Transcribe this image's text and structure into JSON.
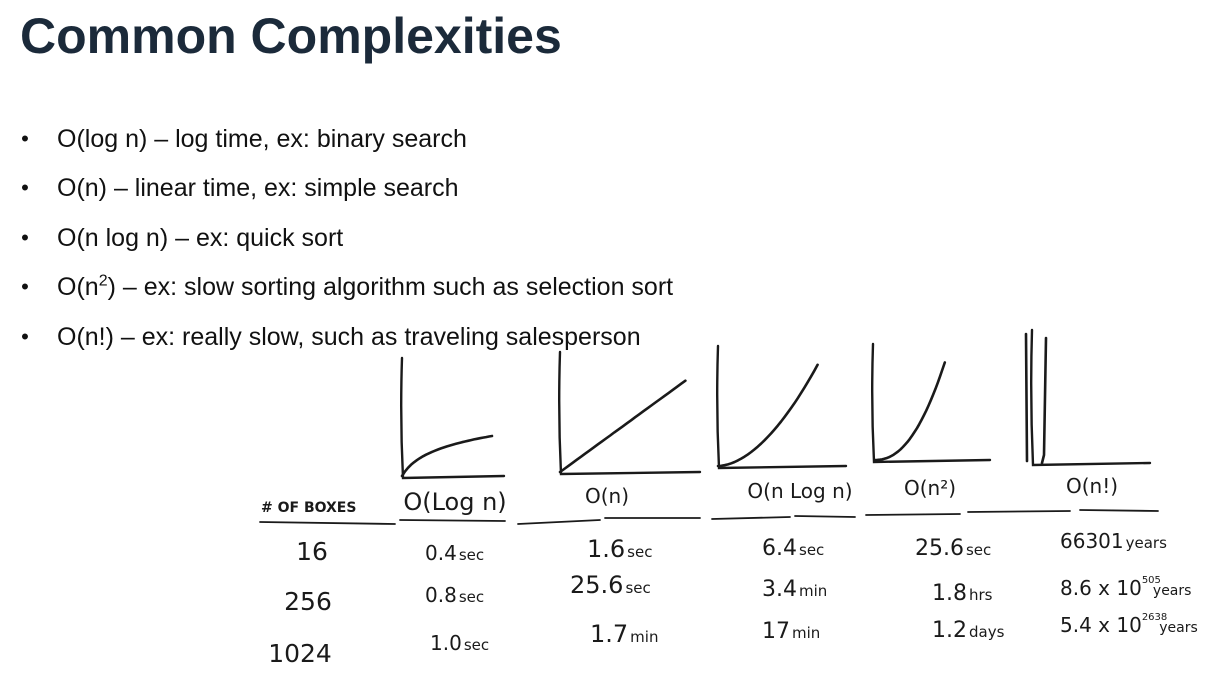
{
  "slide": {
    "title": "Common Complexities",
    "bullets": [
      {
        "marker": "•",
        "text_before": "O(log n) – log time, ex: binary search",
        "sup": "",
        "text_after": ""
      },
      {
        "marker": "•",
        "text_before": "O(n) – linear time, ex: simple search",
        "sup": "",
        "text_after": ""
      },
      {
        "marker": "•",
        "text_before": "O(n log n) – ex: quick sort",
        "sup": "",
        "text_after": ""
      },
      {
        "marker": "•",
        "text_before": "O(n",
        "sup": "2",
        "text_after": ") – ex: slow sorting algorithm such as selection sort"
      },
      {
        "marker": "•",
        "text_before": "O(n!) – ex: really slow, such as traveling salesperson",
        "sup": "",
        "text_after": ""
      }
    ]
  },
  "sketch": {
    "row_header": "# OF BOXES",
    "columns": [
      {
        "label": "O(Log n)",
        "curve": "log"
      },
      {
        "label": "O(n)",
        "curve": "linear"
      },
      {
        "label": "O(n Log n)",
        "curve": "nlogn"
      },
      {
        "label": "O(n²)",
        "curve": "square"
      },
      {
        "label": "O(n!)",
        "curve": "factorial"
      }
    ],
    "rows": [
      {
        "boxes": "16",
        "cells": [
          {
            "value": "0.4",
            "unit": "sec",
            "exp": ""
          },
          {
            "value": "1.6",
            "unit": "sec",
            "exp": ""
          },
          {
            "value": "6.4",
            "unit": "sec",
            "exp": ""
          },
          {
            "value": "25.6",
            "unit": "sec",
            "exp": ""
          },
          {
            "value": "66301",
            "unit": "years",
            "exp": ""
          }
        ]
      },
      {
        "boxes": "256",
        "cells": [
          {
            "value": "0.8",
            "unit": "sec",
            "exp": ""
          },
          {
            "value": "25.6",
            "unit": "sec",
            "exp": ""
          },
          {
            "value": "3.4",
            "unit": "min",
            "exp": ""
          },
          {
            "value": "1.8",
            "unit": "hrs",
            "exp": ""
          },
          {
            "value": "8.6 x 10",
            "unit": "years",
            "exp": "505"
          }
        ]
      },
      {
        "boxes": "1024",
        "cells": [
          {
            "value": "1.0",
            "unit": "sec",
            "exp": ""
          },
          {
            "value": "1.7",
            "unit": "min",
            "exp": ""
          },
          {
            "value": "17",
            "unit": "min",
            "exp": ""
          },
          {
            "value": "1.2",
            "unit": "days",
            "exp": ""
          },
          {
            "value": "5.4 x 10",
            "unit": "years",
            "exp": "2638"
          }
        ]
      }
    ]
  }
}
